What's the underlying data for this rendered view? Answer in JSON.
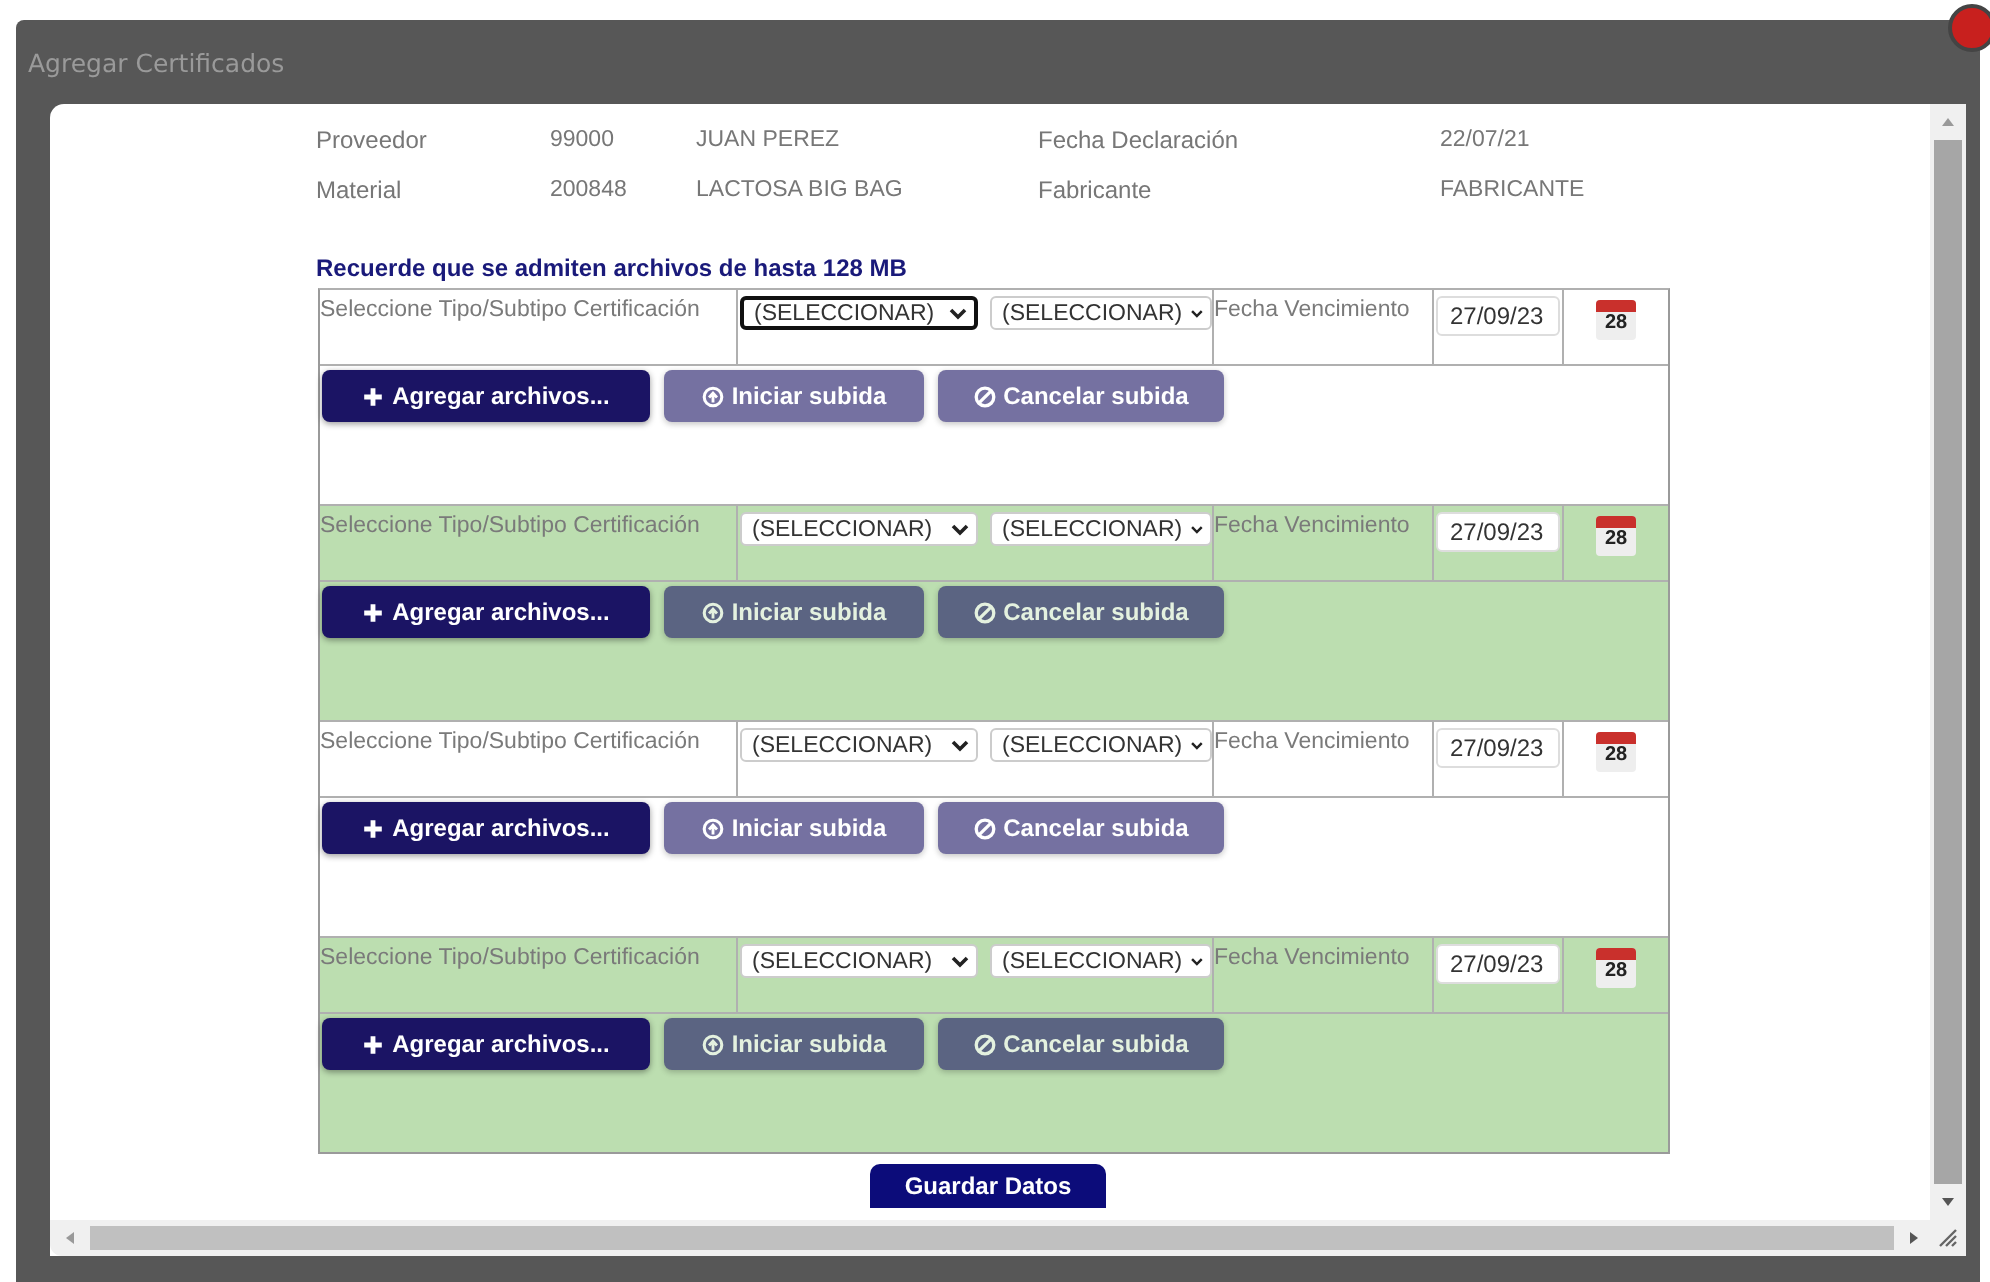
{
  "window": {
    "title": "Agregar Certificados"
  },
  "header": [
    {
      "label": "Proveedor",
      "code": "99000",
      "name": "JUAN PEREZ",
      "label_2": "Fecha Declaración",
      "value_2": "22/07/21"
    },
    {
      "label": "Material",
      "code": "200848",
      "name": "LACTOSA BIG BAG",
      "label_2": "Fabricante",
      "value_2": "FABRICANTE"
    }
  ],
  "notice": "Recuerde que se admiten archivos de hasta 128 MB",
  "certificates": [
    {
      "type_label": "Seleccione Tipo/Subtipo Certificación",
      "type_select": {
        "value": "(SELECCIONAR)",
        "focused": true
      },
      "subtype_select": {
        "value": "(SELECCIONAR)",
        "focused": false
      },
      "date_label": "Fecha Vencimiento",
      "date": "27/09/23",
      "calendar_day": "28",
      "buttons": [
        {
          "kind": "add",
          "label": "Agregar archivos...",
          "disabled": false
        },
        {
          "kind": "start",
          "label": "Iniciar subida",
          "disabled": true
        },
        {
          "kind": "cancel",
          "label": "Cancelar subida",
          "disabled": true
        }
      ]
    },
    {
      "type_label": "Seleccione Tipo/Subtipo Certificación",
      "type_select": {
        "value": "(SELECCIONAR)",
        "focused": false
      },
      "subtype_select": {
        "value": "(SELECCIONAR)",
        "focused": false
      },
      "date_label": "Fecha Vencimiento",
      "date": "27/09/23",
      "calendar_day": "28",
      "buttons": [
        {
          "kind": "add",
          "label": "Agregar archivos...",
          "disabled": false
        },
        {
          "kind": "start",
          "label": "Iniciar subida",
          "disabled": true
        },
        {
          "kind": "cancel",
          "label": "Cancelar subida",
          "disabled": true
        }
      ]
    },
    {
      "type_label": "Seleccione Tipo/Subtipo Certificación",
      "type_select": {
        "value": "(SELECCIONAR)",
        "focused": false
      },
      "subtype_select": {
        "value": "(SELECCIONAR)",
        "focused": false
      },
      "date_label": "Fecha Vencimiento",
      "date": "27/09/23",
      "calendar_day": "28",
      "buttons": [
        {
          "kind": "add",
          "label": "Agregar archivos...",
          "disabled": false
        },
        {
          "kind": "start",
          "label": "Iniciar subida",
          "disabled": true
        },
        {
          "kind": "cancel",
          "label": "Cancelar subida",
          "disabled": true
        }
      ]
    },
    {
      "type_label": "Seleccione Tipo/Subtipo Certificación",
      "type_select": {
        "value": "(SELECCIONAR)",
        "focused": false
      },
      "subtype_select": {
        "value": "(SELECCIONAR)",
        "focused": false
      },
      "date_label": "Fecha Vencimiento",
      "date": "27/09/23",
      "calendar_day": "28",
      "buttons": [
        {
          "kind": "add",
          "label": "Agregar archivos...",
          "disabled": false
        },
        {
          "kind": "start",
          "label": "Iniciar subida",
          "disabled": true
        },
        {
          "kind": "cancel",
          "label": "Cancelar subida",
          "disabled": true
        }
      ]
    }
  ],
  "save_button": "Guardar Datos"
}
